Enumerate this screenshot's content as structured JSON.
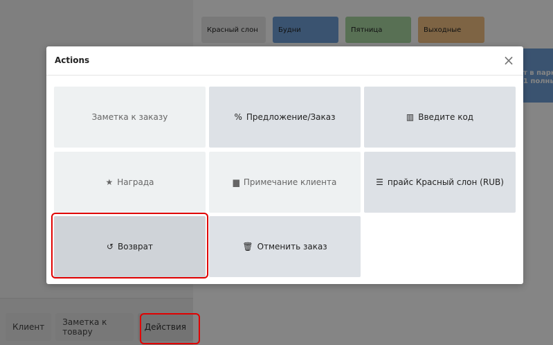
{
  "pricelists": {
    "red": "Красный слон",
    "weekday": "Будни",
    "friday": "Пятница",
    "weekend": "Выходные"
  },
  "product_card": {
    "line1": "т в парк",
    "line2": "1 полны"
  },
  "bottom_bar": {
    "client": "Клиент",
    "product_note": "Заметка к товару",
    "actions": "Действия"
  },
  "modal": {
    "title": "Actions",
    "close_glyph": "×",
    "tiles": [
      {
        "label": "Заметка к заказу",
        "icon": ""
      },
      {
        "label": "Предложение/Заказ",
        "icon": "%"
      },
      {
        "label": "Введите код",
        "icon": "▥"
      },
      {
        "label": "Награда",
        "icon": "★"
      },
      {
        "label": "Примечание клиента",
        "icon": "▆"
      },
      {
        "label": "прайс Красный слон (RUB)",
        "icon": "☰"
      },
      {
        "label": "Возврат",
        "icon": "↺"
      },
      {
        "label": "Отменить заказ",
        "icon": "🗑"
      }
    ]
  },
  "colors": {
    "weekday": "#6fa0d6",
    "friday": "#a9d6a2",
    "weekend": "#f1c082",
    "highlight": "#e00000"
  }
}
